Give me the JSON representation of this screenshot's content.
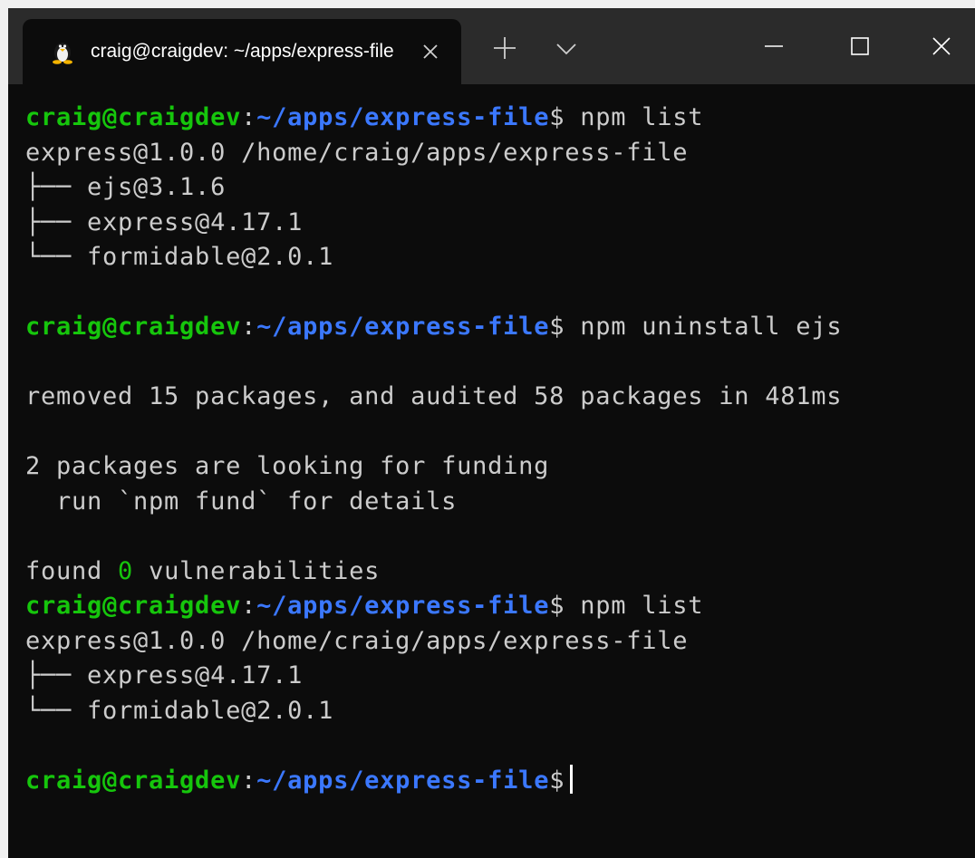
{
  "window": {
    "tab_title": "craig@craigdev: ~/apps/express-file",
    "tab_icon": "linux-tux-icon",
    "colors": {
      "titlebar": "#2b2b2b",
      "background": "#0c0c0c",
      "text": "#cccccc",
      "user_host": "#16c60c",
      "path": "#3b78ff"
    }
  },
  "terminal": {
    "prompt": {
      "user_host": "craig@craigdev",
      "sep": ":",
      "path": "~/apps/express-file",
      "symbol": "$"
    },
    "cmd1": "npm list",
    "list1": {
      "root": "express@1.0.0 /home/craig/apps/express-file",
      "items": [
        "├── ejs@3.1.6",
        "├── express@4.17.1",
        "└── formidable@2.0.1"
      ]
    },
    "cmd2": "npm uninstall ejs",
    "removed_line": "removed 15 packages, and audited 58 packages in 481ms",
    "funding_line1": "2 packages are looking for funding",
    "funding_line2": "  run `npm fund` for details",
    "vuln": {
      "prefix": "found ",
      "count": "0",
      "suffix": " vulnerabilities"
    },
    "cmd3": "npm list",
    "list2": {
      "root": "express@1.0.0 /home/craig/apps/express-file",
      "items": [
        "├── express@4.17.1",
        "└── formidable@2.0.1"
      ]
    },
    "cmd4": ""
  }
}
